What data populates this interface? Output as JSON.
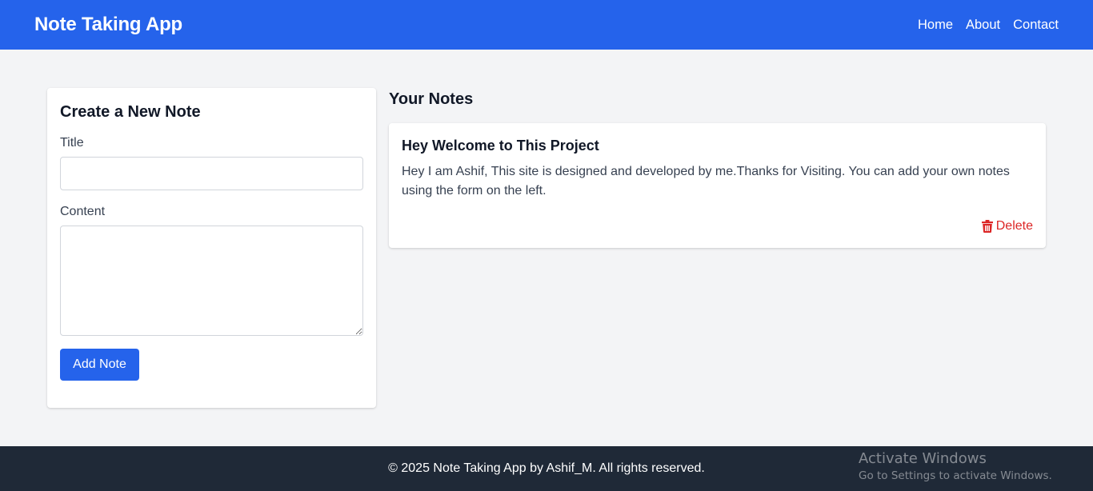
{
  "navbar": {
    "brand": "Note Taking App",
    "links": [
      {
        "label": "Home"
      },
      {
        "label": "About"
      },
      {
        "label": "Contact"
      }
    ]
  },
  "form": {
    "heading": "Create a New Note",
    "title_label": "Title",
    "title_value": "",
    "content_label": "Content",
    "content_value": "",
    "submit_label": "Add Note"
  },
  "notes": {
    "heading": "Your Notes",
    "items": [
      {
        "title": "Hey Welcome to This Project",
        "content": "Hey I am Ashif, This site is designed and developed by me.Thanks for Visiting. You can add your own notes using the form on the left.",
        "delete_label": "Delete",
        "delete_icon": "trash-icon"
      }
    ]
  },
  "footer": {
    "text": "© 2025 Note Taking App by Ashif_M. All rights reserved."
  },
  "watermark": {
    "title": "Activate Windows",
    "subtitle": "Go to Settings to activate Windows."
  },
  "colors": {
    "primary": "#2563eb",
    "danger": "#dc2626",
    "footer_bg": "#1f2937",
    "page_bg": "#f3f4f6"
  }
}
